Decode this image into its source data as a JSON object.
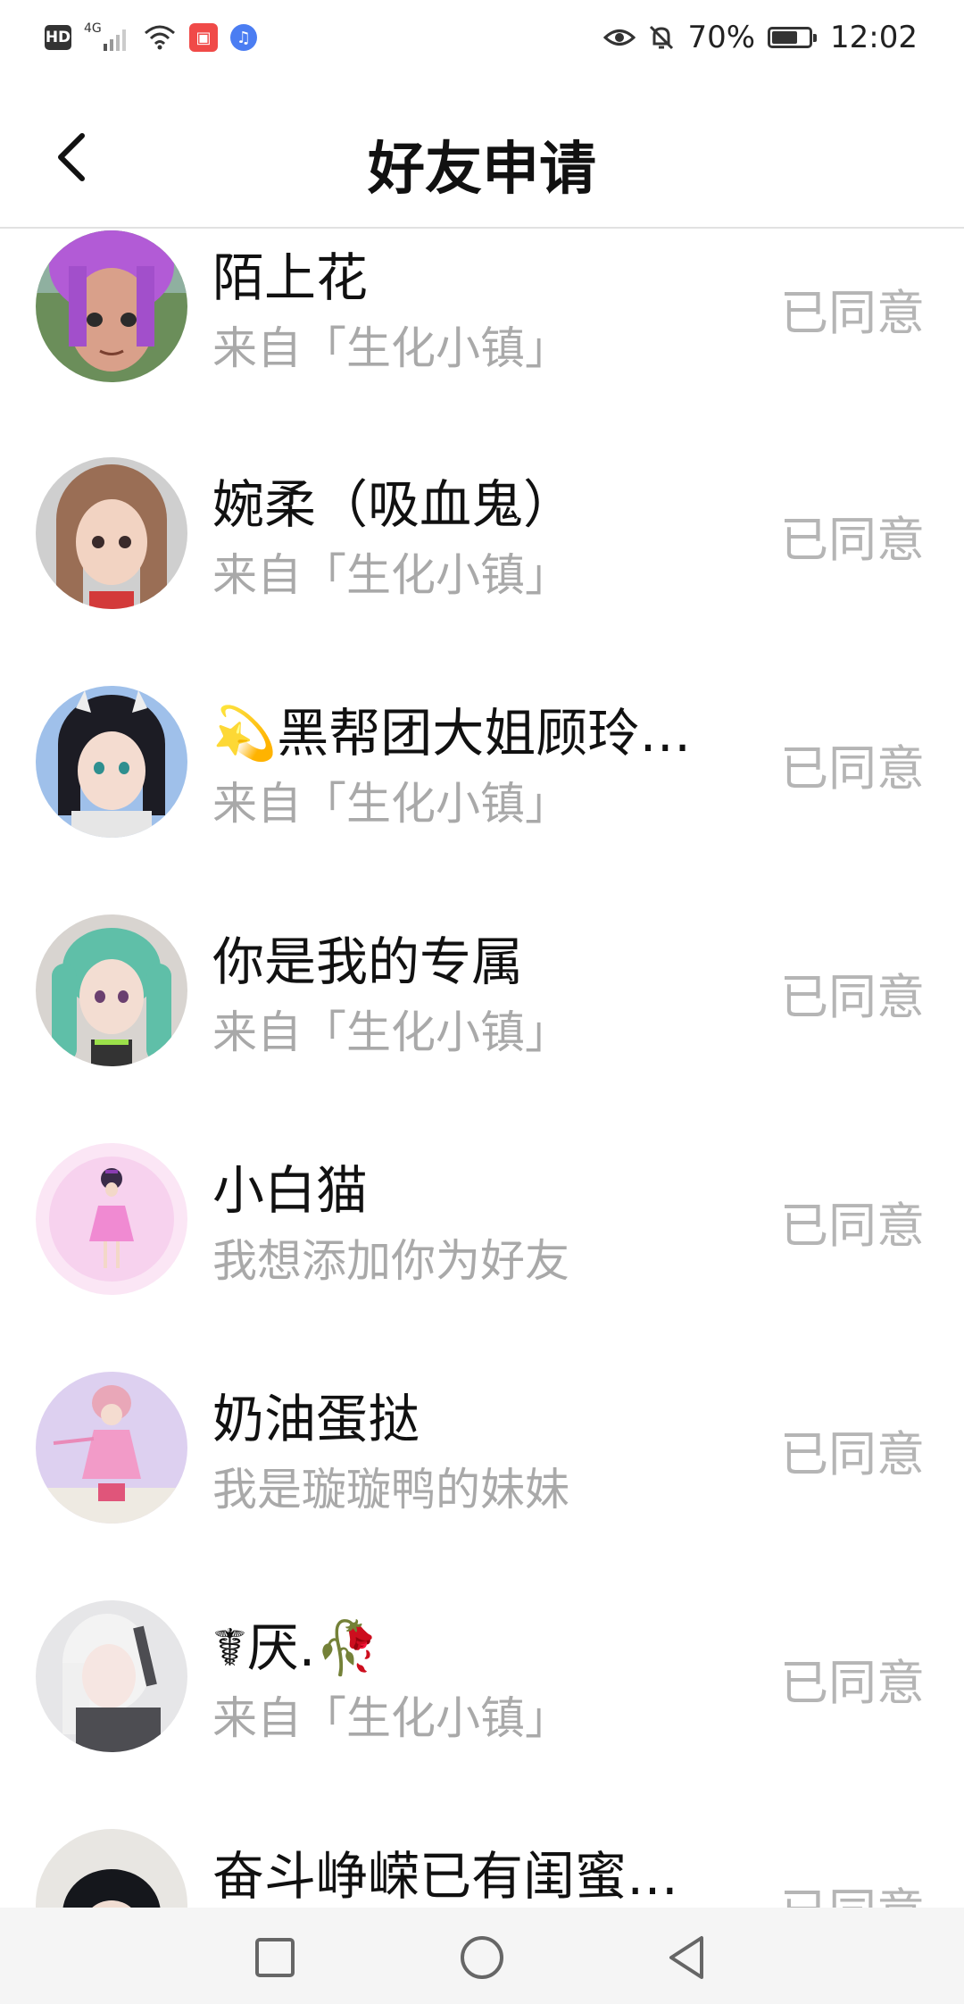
{
  "status_bar": {
    "hd": "HD",
    "network": "4G",
    "battery_percent": "70%",
    "battery_level": 0.7,
    "time": "12:02",
    "icons": [
      "signal-icon",
      "wifi-icon",
      "app-notification-icon",
      "music-app-icon",
      "eye-icon",
      "bell-off-icon",
      "battery-icon"
    ]
  },
  "header": {
    "title": "好友申请",
    "back_icon": "chevron-left-icon"
  },
  "requests": [
    {
      "name": "陌上花",
      "message": "来自「生化小镇」",
      "status": "已同意"
    },
    {
      "name": "婉柔（吸血鬼）",
      "message": "来自「生化小镇」",
      "status": "已同意"
    },
    {
      "name": "💫黑帮团大姐顾玲…",
      "message": "来自「生化小镇」",
      "status": "已同意"
    },
    {
      "name": "你是我的专属",
      "message": "来自「生化小镇」",
      "status": "已同意"
    },
    {
      "name": "小白猫",
      "message": "我想添加你为好友",
      "status": "已同意"
    },
    {
      "name": "奶油蛋挞",
      "message": "我是璇璇鸭的妹妹",
      "status": "已同意"
    },
    {
      "name": "☤厌.🥀",
      "message": "来自「生化小镇」",
      "status": "已同意"
    },
    {
      "name": "奋斗峥嵘已有闺蜜…",
      "message": "",
      "status": "已同意"
    }
  ],
  "nav_bar": {
    "icons": [
      "recent-apps-icon",
      "home-icon",
      "back-icon"
    ]
  }
}
